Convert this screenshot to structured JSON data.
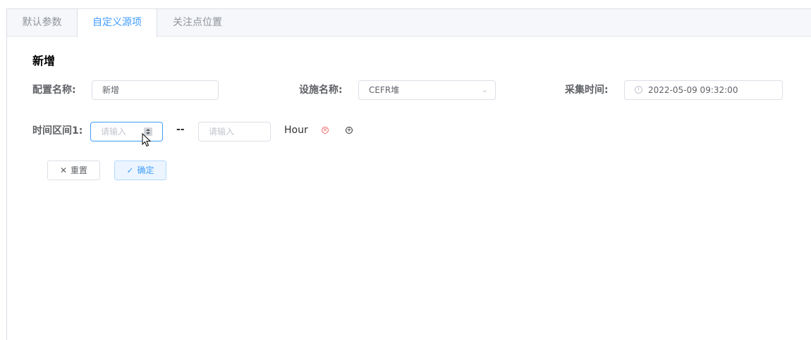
{
  "tabs": [
    {
      "label": "默认参数"
    },
    {
      "label": "自定义源项"
    },
    {
      "label": "关注点位置"
    }
  ],
  "active_tab_index": 1,
  "section_title": "新增",
  "form": {
    "config_name_label": "配置名称:",
    "config_name_value": "新增",
    "facility_label": "设施名称:",
    "facility_value": "CEFR堆",
    "collect_time_label": "采集时间:",
    "collect_time_value": "2022-05-09 09:32:00",
    "interval_label": "时间区间1:",
    "interval_start_placeholder": "请输入",
    "interval_separator": "--",
    "interval_end_placeholder": "请输入",
    "interval_unit": "Hour"
  },
  "buttons": {
    "reset_label": "重置",
    "confirm_label": "确定"
  },
  "colors": {
    "accent": "#409eff",
    "danger": "#f56c6c"
  }
}
